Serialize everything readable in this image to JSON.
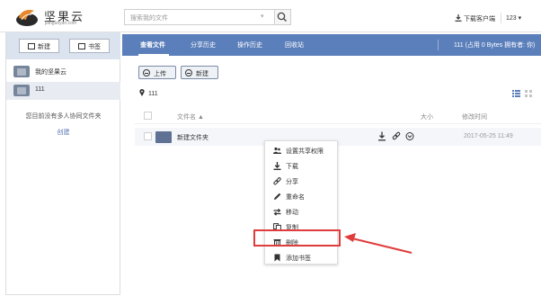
{
  "header": {
    "logo_title": "坚果云",
    "logo_sub": "jianguoyun.com",
    "search_placeholder": "搜索我的文件",
    "download_client": "下载客户端",
    "user": "123"
  },
  "sidebar": {
    "new_label": "新建",
    "bookmark_label": "书签",
    "items": [
      {
        "label": "我的坚果云"
      },
      {
        "label": "111"
      }
    ],
    "note": "您目前没有多人协同文件夹",
    "create_label": "创建"
  },
  "nav": {
    "tabs": [
      {
        "label": "查看文件"
      },
      {
        "label": "分享历史"
      },
      {
        "label": "操作历史"
      },
      {
        "label": "回收站"
      }
    ],
    "info": "111 (占用 0 Bytes  拥有者: 你)"
  },
  "toolbar": {
    "upload_label": "上传",
    "new_label": "新建"
  },
  "location": "111",
  "table": {
    "columns": {
      "name": "文件名 ▲",
      "size": "大小",
      "date": "修改时间"
    },
    "rows": [
      {
        "name": "新建文件夹",
        "size": "",
        "date": "2017-05-25 11:49"
      }
    ]
  },
  "context_menu": {
    "items": [
      {
        "label": "设置共享权限",
        "icon": "users-icon"
      },
      {
        "label": "下载",
        "icon": "download-icon"
      },
      {
        "label": "分享",
        "icon": "link-icon"
      },
      {
        "label": "重命名",
        "icon": "pencil-icon"
      },
      {
        "label": "移动",
        "icon": "move-icon"
      },
      {
        "label": "复制",
        "icon": "copy-icon"
      },
      {
        "label": "删除",
        "icon": "trash-icon"
      },
      {
        "label": "添加书签",
        "icon": "bookmark-icon"
      }
    ],
    "highlighted": "删除"
  },
  "colors": {
    "nav_bg": "#5b7fbb",
    "annotation": "#e03c3c",
    "sidebar_top": "#dbe3ee"
  }
}
